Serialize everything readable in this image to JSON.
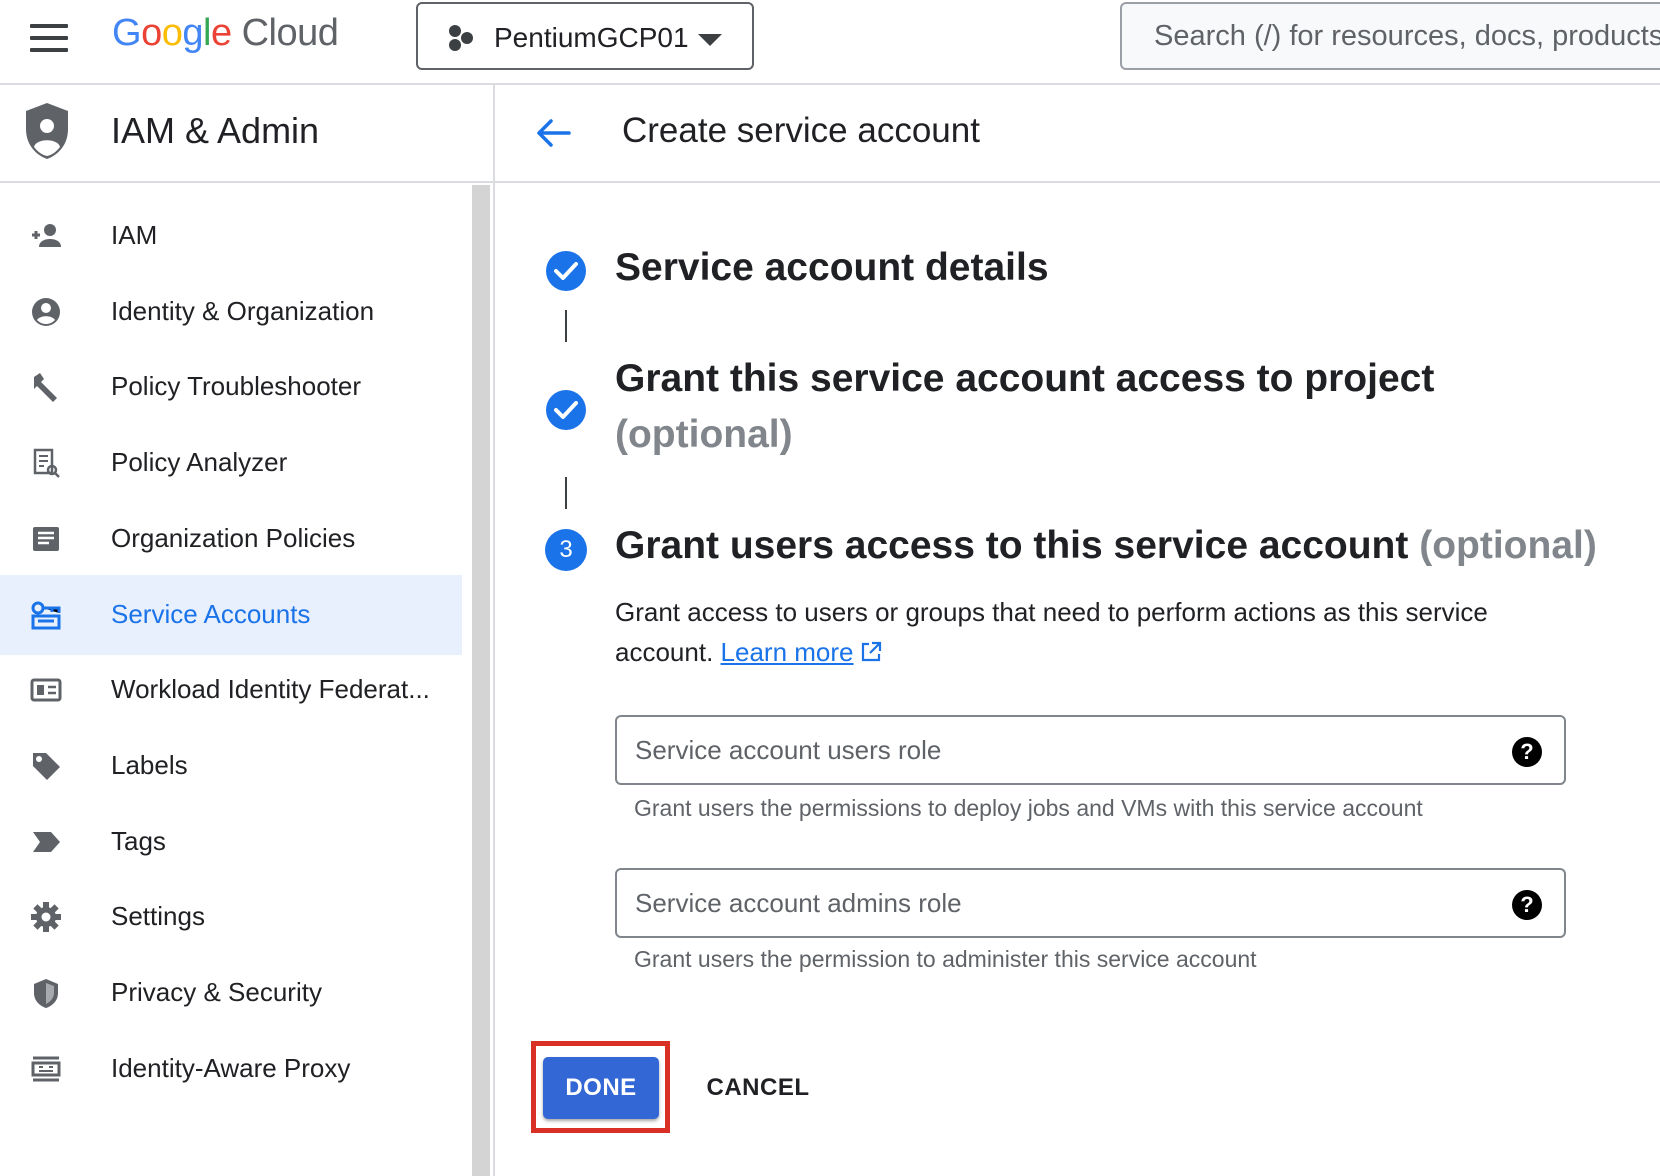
{
  "topbar": {
    "logo_google": [
      "G",
      "o",
      "o",
      "g",
      "l",
      "e"
    ],
    "logo_cloud": "Cloud",
    "project_name": "PentiumGCP01",
    "search_placeholder": "Search (/) for resources, docs, products, and more"
  },
  "sidebar": {
    "title": "IAM & Admin",
    "items": [
      {
        "label": "IAM",
        "icon": "person-add-icon",
        "active": false
      },
      {
        "label": "Identity & Organization",
        "icon": "account-circle-icon",
        "active": false
      },
      {
        "label": "Policy Troubleshooter",
        "icon": "wrench-icon",
        "active": false
      },
      {
        "label": "Policy Analyzer",
        "icon": "document-search-icon",
        "active": false
      },
      {
        "label": "Organization Policies",
        "icon": "list-document-icon",
        "active": false
      },
      {
        "label": "Service Accounts",
        "icon": "service-account-icon",
        "active": true
      },
      {
        "label": "Workload Identity Federat...",
        "icon": "id-card-icon",
        "active": false
      },
      {
        "label": "Labels",
        "icon": "label-tag-icon",
        "active": false
      },
      {
        "label": "Tags",
        "icon": "tag-arrow-icon",
        "active": false
      },
      {
        "label": "Settings",
        "icon": "gear-icon",
        "active": false
      },
      {
        "label": "Privacy & Security",
        "icon": "shield-icon",
        "active": false
      },
      {
        "label": "Identity-Aware Proxy",
        "icon": "proxy-icon",
        "active": false
      }
    ]
  },
  "main": {
    "page_title": "Create service account",
    "steps": [
      {
        "title": "Service account details",
        "optional": "",
        "status": "complete"
      },
      {
        "title": "Grant this service account access to project",
        "optional": "(optional)",
        "status": "complete"
      },
      {
        "number": "3",
        "title": "Grant users access to this service account",
        "optional": "(optional)",
        "status": "current"
      }
    ],
    "description": "Grant access to users or groups that need to perform actions as this service account.",
    "learn_more": "Learn more",
    "fields": [
      {
        "placeholder": "Service account users role",
        "hint": "Grant users the permissions to deploy jobs and VMs with this service account"
      },
      {
        "placeholder": "Service account admins role",
        "hint": "Grant users the permission to administer this service account"
      }
    ],
    "done_label": "DONE",
    "cancel_label": "CANCEL"
  },
  "colors": {
    "accent": "#1a73e8",
    "done_button": "#3367d6",
    "highlight_box": "#d93025",
    "active_nav_bg": "#e8f0fe"
  }
}
